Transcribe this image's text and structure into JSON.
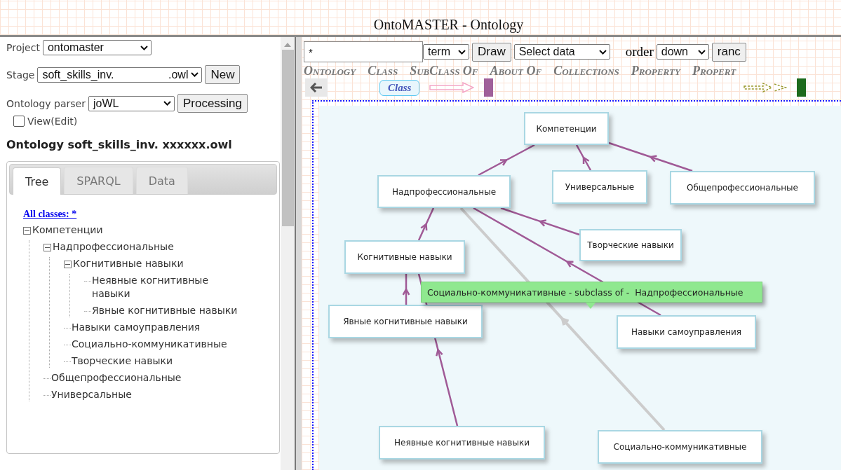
{
  "window": {
    "title": "OntoMASTER - Ontology"
  },
  "sidebar": {
    "project": {
      "label": "Project",
      "value": "ontomaster"
    },
    "stage": {
      "label": "Stage",
      "value": "soft_skills_inv.",
      "value_end": ".owl",
      "button": "New"
    },
    "parser": {
      "label": "Ontology parser",
      "value": "joWL",
      "button": "Processing"
    },
    "view_edit": {
      "label": "View(Edit)",
      "checked": false
    },
    "heading": "Ontology soft_skills_inv. xxxxxx.owl",
    "tabs": [
      {
        "label": "Tree",
        "selected": true
      },
      {
        "label": "SPARQL",
        "selected": false
      },
      {
        "label": "Data",
        "selected": false
      }
    ],
    "tree_link": "All classes: *",
    "tree": [
      {
        "label": "Компетенции",
        "expanded": true,
        "children": [
          {
            "label": "Надпрофессиональные",
            "expanded": true,
            "children": [
              {
                "label": "Когнитивные навыки",
                "expanded": true,
                "children": [
                  {
                    "label": "Неявные когнитивные навыки"
                  },
                  {
                    "label": "Явные когнитивные навыки"
                  }
                ]
              },
              {
                "label": "Навыки самоуправления"
              },
              {
                "label": "Социально-коммуникативные"
              },
              {
                "label": "Творческие навыки"
              }
            ]
          },
          {
            "label": "Общепрофессиональные"
          },
          {
            "label": "Универсальные"
          }
        ]
      }
    ]
  },
  "toolbar": {
    "search": {
      "value": "*"
    },
    "term_select": "term",
    "draw_button": "Draw",
    "data_select": "Select data",
    "order_label": "order",
    "order_select": "down",
    "ranc_button": "ranc"
  },
  "menu": [
    "Ontology",
    "Class",
    "SubClass Of",
    "About Of",
    "Collections",
    "Property",
    "Propert"
  ],
  "legend": {
    "class_label": "Class"
  },
  "graph": {
    "nodes": [
      "Компетенции",
      "Надпрофессиональные",
      "Универсальные",
      "Общепрофессиональные",
      "Когнитивные навыки",
      "Творческие навыки",
      "Явные когнитивные навыки",
      "Навыки самоуправления",
      "Неявные когнитивные навыки",
      "Социально-коммуникативные"
    ],
    "edges": [
      {
        "selected": false
      },
      {
        "selected": false
      },
      {
        "selected": false
      },
      {
        "selected": false
      },
      {
        "selected": false
      },
      {
        "selected": false
      },
      {
        "selected": false
      },
      {
        "selected": false
      },
      {
        "selected": true
      }
    ],
    "tooltip": "Социально-коммуникативные - subclass of -  Надпрофессиональные"
  }
}
